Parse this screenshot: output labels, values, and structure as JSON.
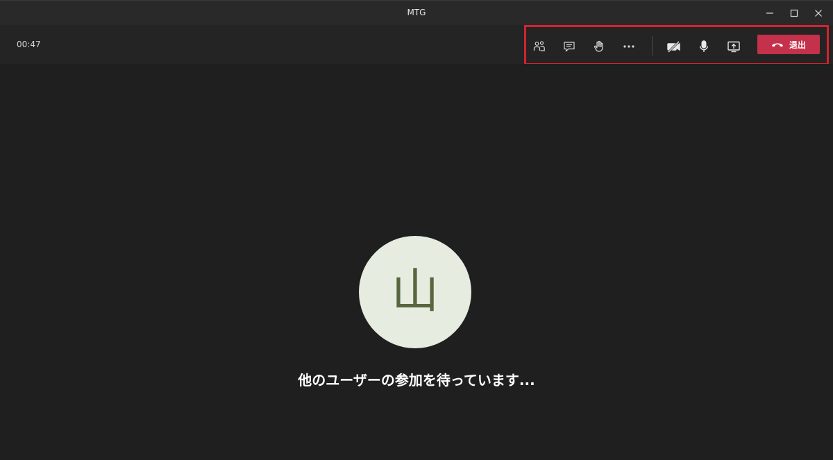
{
  "window": {
    "title": "MTG"
  },
  "toolbar": {
    "timer": "00:47",
    "leave_label": "退出",
    "leave_color": "#c4314b",
    "highlight_color": "#d3232f",
    "icons": [
      "participants-icon",
      "chat-icon",
      "raise-hand-icon",
      "more-options-icon",
      "camera-off-icon",
      "microphone-icon",
      "share-screen-icon",
      "hang-up-icon"
    ]
  },
  "stage": {
    "avatar_initial": "山",
    "avatar_bg": "#e6ecdf",
    "waiting_text": "他のユーザーの参加を待っています..."
  },
  "window_controls": [
    "minimize-icon",
    "maximize-icon",
    "close-icon"
  ]
}
